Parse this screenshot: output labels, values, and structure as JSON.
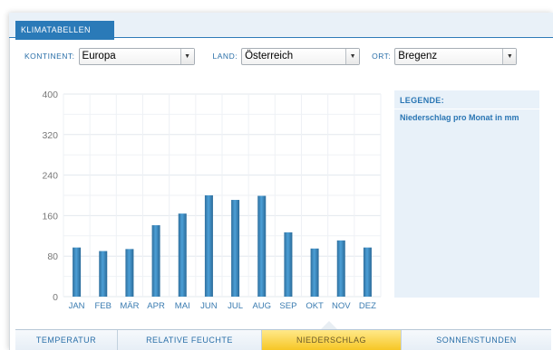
{
  "header": {
    "title": "KLIMATABELLEN"
  },
  "filters": {
    "continent": {
      "label": "KONTINENT:",
      "value": "Europa"
    },
    "country": {
      "label": "LAND:",
      "value": "Österreich"
    },
    "place": {
      "label": "ORT:",
      "value": "Bregenz"
    }
  },
  "legend": {
    "title": "LEGENDE:",
    "item": "Niederschlag pro Monat in mm"
  },
  "tabs": [
    {
      "label": "TEMPERATUR",
      "active": false
    },
    {
      "label": "RELATIVE FEUCHTE",
      "active": false
    },
    {
      "label": "NIEDERSCHLAG",
      "active": true
    },
    {
      "label": "SONNENSTUNDEN",
      "active": false
    }
  ],
  "colors": {
    "accent": "#2a7ab8",
    "bar": "#3b8cc4",
    "active_tab": "#f6c521",
    "legend_bg": "#e8f1f9"
  },
  "chart_data": {
    "type": "bar",
    "categories": [
      "JAN",
      "FEB",
      "MÄR",
      "APR",
      "MAI",
      "JUN",
      "JUL",
      "AUG",
      "SEP",
      "OKT",
      "NOV",
      "DEZ"
    ],
    "series": [
      {
        "name": "Niederschlag pro Monat in mm",
        "values": [
          97,
          90,
          94,
          141,
          164,
          200,
          191,
          199,
          127,
          95,
          111,
          97
        ]
      }
    ],
    "yticks": [
      0,
      80,
      160,
      240,
      320,
      400
    ],
    "ylim": [
      0,
      400
    ],
    "grid": true
  }
}
